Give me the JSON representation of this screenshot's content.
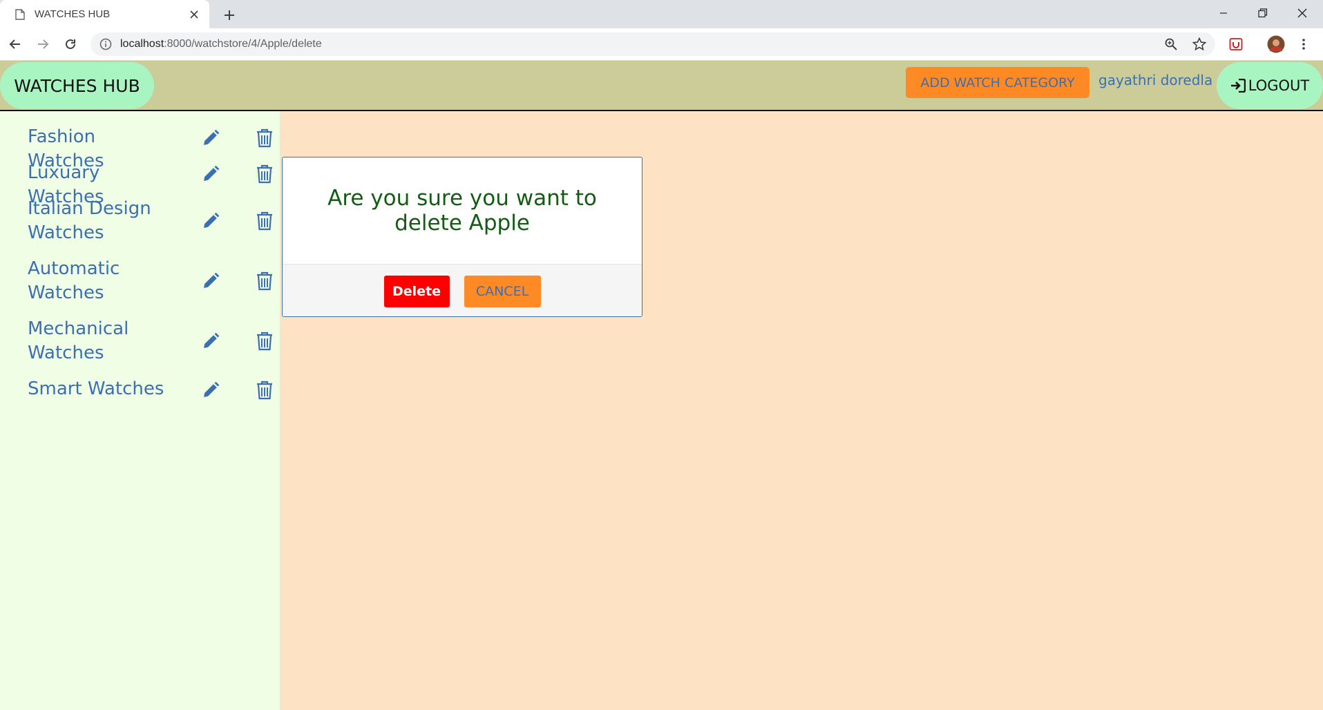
{
  "browser": {
    "tab_title": "WATCHES HUB",
    "url_host": "localhost",
    "url_path": ":8000/watchstore/4/Apple/delete"
  },
  "header": {
    "brand": "WATCHES HUB",
    "add_category_label": "ADD WATCH CATEGORY",
    "user_name": "gayathri doredla",
    "logout_label": "LOGOUT"
  },
  "sidebar": {
    "categories": [
      {
        "label": "Fashion Watches"
      },
      {
        "label": "Luxuary Watches"
      },
      {
        "label": "Italian Design Watches"
      },
      {
        "label": "Automatic Watches"
      },
      {
        "label": "Mechanical Watches"
      },
      {
        "label": "Smart Watches"
      }
    ]
  },
  "modal": {
    "message": "Are you sure you want to delete Apple",
    "delete_label": "Delete",
    "cancel_label": "CANCEL"
  },
  "colors": {
    "header_bg": "#cccc99",
    "brand_pill": "#a8f5c2",
    "accent_orange": "#fd8a24",
    "link_blue": "#3c6fb0",
    "delete_red": "#ff0000",
    "page_bg": "#fde3c3",
    "sidebar_bg": "#f0fee6",
    "modal_text_green": "#145c14"
  },
  "icons": {
    "edit": "pencil-icon",
    "delete": "trash-icon",
    "logout": "sign-in-icon"
  }
}
